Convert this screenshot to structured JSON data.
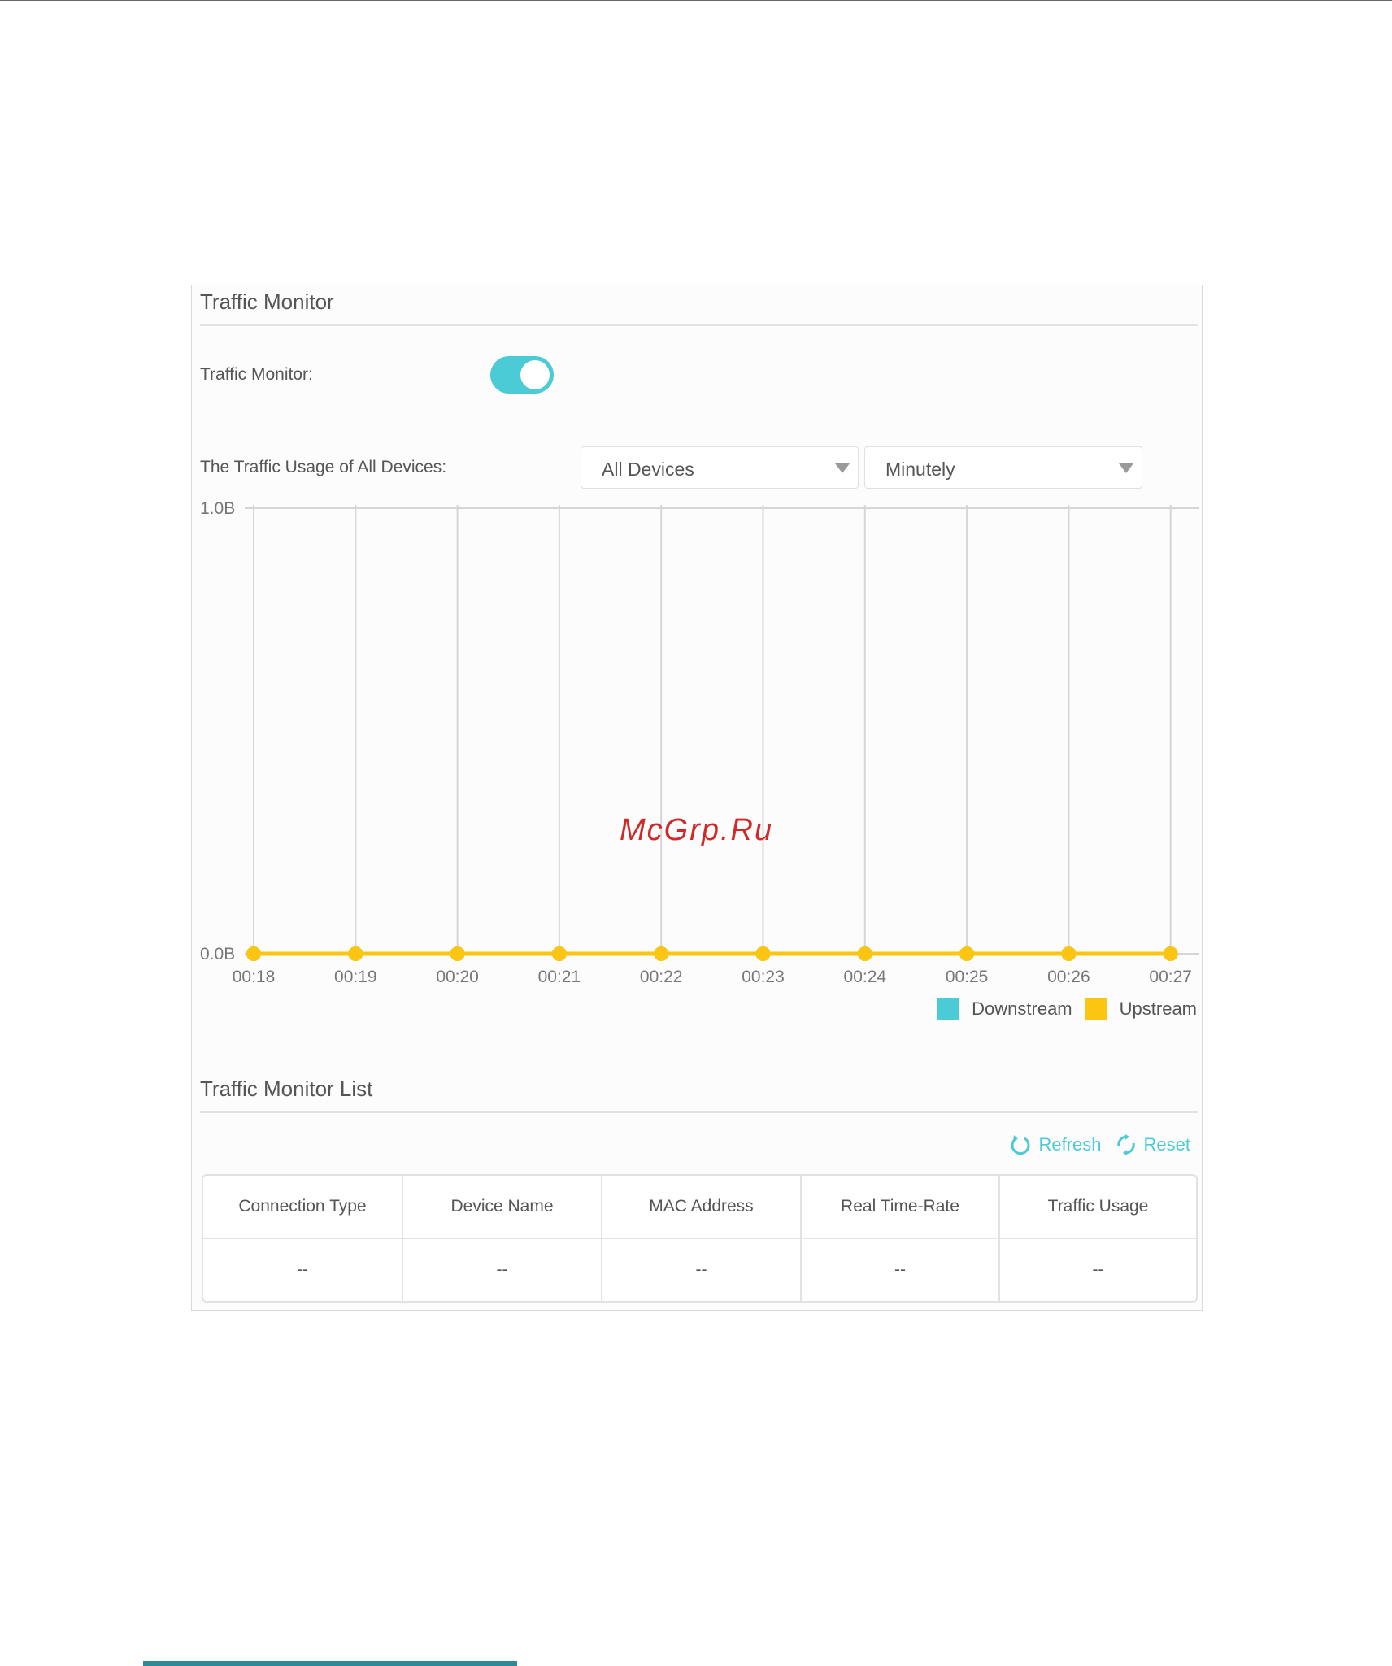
{
  "panel": {
    "title": "Traffic Monitor",
    "toggle_label": "Traffic Monitor:",
    "toggle_on": true,
    "usage_label": "The Traffic Usage of All Devices:",
    "device_select": {
      "value": "All Devices"
    },
    "interval_select": {
      "value": "Minutely"
    }
  },
  "colors": {
    "accent": "#4acbd6",
    "downstream": "#4acbd6",
    "upstream": "#fcc512"
  },
  "chart_data": {
    "type": "line",
    "categories": [
      "00:18",
      "00:19",
      "00:20",
      "00:21",
      "00:22",
      "00:23",
      "00:24",
      "00:25",
      "00:26",
      "00:27"
    ],
    "yticks": [
      "0.0B",
      "1.0B"
    ],
    "ylim": [
      0,
      1
    ],
    "series": [
      {
        "name": "Downstream",
        "color": "#4acbd6",
        "values": [
          0,
          0,
          0,
          0,
          0,
          0,
          0,
          0,
          0,
          0
        ]
      },
      {
        "name": "Upstream",
        "color": "#fcc512",
        "values": [
          0,
          0,
          0,
          0,
          0,
          0,
          0,
          0,
          0,
          0
        ]
      }
    ],
    "legend_position": "bottom-right",
    "grid": "vertical"
  },
  "list": {
    "title": "Traffic Monitor List",
    "refresh_label": "Refresh",
    "reset_label": "Reset",
    "columns": [
      "Connection Type",
      "Device Name",
      "MAC Address",
      "Real Time-Rate",
      "Traffic Usage"
    ],
    "rows": [
      [
        "--",
        "--",
        "--",
        "--",
        "--"
      ]
    ]
  },
  "watermark": "McGrp.Ru"
}
